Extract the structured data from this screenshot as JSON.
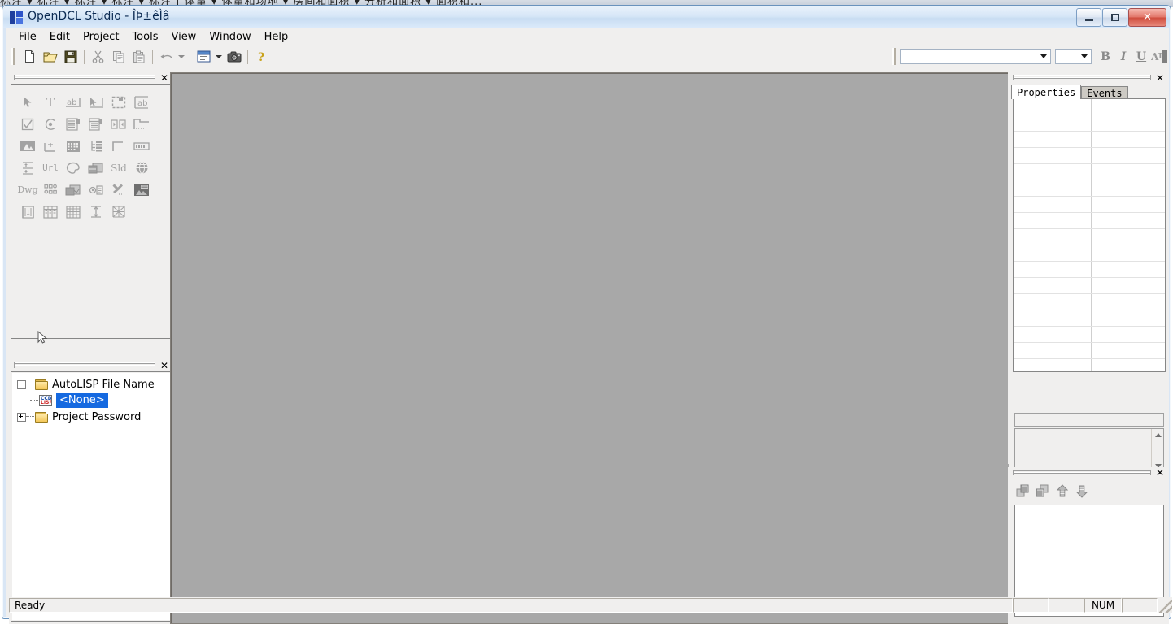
{
  "background_window": {
    "strip_text": "标注 ▾ 标注 ▾ 标注 ▾ 标注 ▾ 标注 | 体量 ▾ 体量和场地 ▾ 房间和面积 ▾ 分析和面积 ▾ 面积和..."
  },
  "window": {
    "title": "OpenDCL Studio - ÎÞ±êÌâ",
    "app_icon": "opendcl-logo-icon",
    "controls": {
      "minimize": "minimize-icon",
      "maximize": "restore-icon",
      "close": "✕"
    }
  },
  "menu": {
    "items": [
      {
        "label": "File"
      },
      {
        "label": "Edit"
      },
      {
        "label": "Project"
      },
      {
        "label": "Tools"
      },
      {
        "label": "View"
      },
      {
        "label": "Window"
      },
      {
        "label": "Help"
      }
    ]
  },
  "standard_toolbar": {
    "buttons": [
      {
        "name": "new-icon",
        "title": "New",
        "enabled": true
      },
      {
        "name": "open-icon",
        "title": "Open",
        "enabled": true
      },
      {
        "name": "save-icon",
        "title": "Save",
        "enabled": true
      },
      {
        "name": "cut-icon",
        "title": "Cut",
        "enabled": false
      },
      {
        "name": "copy-icon",
        "title": "Copy",
        "enabled": false
      },
      {
        "name": "paste-icon",
        "title": "Paste",
        "enabled": false
      },
      {
        "name": "undo-icon",
        "title": "Undo",
        "enabled": false
      },
      {
        "name": "new-form-icon",
        "title": "New Form",
        "enabled": true
      },
      {
        "name": "screenshot-icon",
        "title": "Capture",
        "enabled": true
      },
      {
        "name": "help-icon",
        "title": "Help",
        "enabled": true
      }
    ]
  },
  "format_toolbar": {
    "font_name": {
      "value": "",
      "placeholder": ""
    },
    "font_size": {
      "value": "",
      "placeholder": ""
    },
    "bold_label": "B",
    "italic_label": "I",
    "underline_label": "U",
    "fontcolor_label": "A",
    "fontcolor_swatch": "#808080"
  },
  "toolbox_panel": {
    "close_label": "✕",
    "tools": [
      {
        "name": "select-pointer-icon",
        "glyph": "pointer"
      },
      {
        "name": "label-text-icon",
        "glyph": "T"
      },
      {
        "name": "textbox-icon",
        "glyph": "ab"
      },
      {
        "name": "button-icon",
        "glyph": "btn"
      },
      {
        "name": "dialog-icon",
        "glyph": "dlg"
      },
      {
        "name": "edit-box-icon",
        "glyph": "fab"
      },
      {
        "name": "checkbox-icon",
        "glyph": "check"
      },
      {
        "name": "radio-button-icon",
        "glyph": "radio"
      },
      {
        "name": "listbox-icon",
        "glyph": "list1"
      },
      {
        "name": "listview-icon",
        "glyph": "list2"
      },
      {
        "name": "spinner-icon",
        "glyph": "spin"
      },
      {
        "name": "tab-control-icon",
        "glyph": "tabc"
      },
      {
        "name": "image-control-icon",
        "glyph": "image"
      },
      {
        "name": "angle-control-icon",
        "glyph": "angle"
      },
      {
        "name": "grid-control-icon",
        "glyph": "grid"
      },
      {
        "name": "tree-control-icon",
        "glyph": "tree"
      },
      {
        "name": "frame-icon",
        "glyph": "frame"
      },
      {
        "name": "progressbar-icon",
        "glyph": "progress"
      },
      {
        "name": "align-icon",
        "glyph": "align"
      },
      {
        "name": "url-control-icon",
        "glyph": "Url"
      },
      {
        "name": "color-picker-icon",
        "glyph": "palette"
      },
      {
        "name": "pattern-icon",
        "glyph": "pattern"
      },
      {
        "name": "slide-control-icon",
        "glyph": "Sld"
      },
      {
        "name": "web-browser-icon",
        "glyph": "globe"
      },
      {
        "name": "dwg-control-icon",
        "glyph": "Dwg"
      },
      {
        "name": "block-list-icon",
        "glyph": "blocks"
      },
      {
        "name": "hatch-icon",
        "glyph": "hatch"
      },
      {
        "name": "ole-control-icon",
        "glyph": "ole"
      },
      {
        "name": "tools-icon",
        "glyph": "tools"
      },
      {
        "name": "picture-icon",
        "glyph": "picture"
      },
      {
        "name": "dimension-icon",
        "glyph": "dim"
      },
      {
        "name": "report-icon",
        "glyph": "report"
      },
      {
        "name": "table-icon",
        "glyph": "table"
      },
      {
        "name": "spacing-icon",
        "glyph": "space"
      },
      {
        "name": "mesh-icon",
        "glyph": "mesh"
      }
    ]
  },
  "project_panel": {
    "close_label": "✕",
    "tree": [
      {
        "label": "AutoLISP File Name",
        "icon": "folder-icon",
        "expander": "minus",
        "expanded": true,
        "selected": false,
        "children": [
          {
            "label": "<None>",
            "icon": "lisp-file-icon",
            "selected": true
          }
        ]
      },
      {
        "label": "Project Password",
        "icon": "folder-icon",
        "expander": "plus",
        "expanded": false,
        "selected": false,
        "children": []
      }
    ]
  },
  "properties_panel": {
    "close_label": "✕",
    "tabs": [
      {
        "label": "Properties",
        "active": true
      },
      {
        "label": "Events",
        "active": false
      }
    ],
    "grid": {
      "rows": [],
      "row_count": 17,
      "empty": true
    },
    "description": "",
    "scroll": {
      "up": "scroll-up-arrow",
      "down": "scroll-down-arrow"
    }
  },
  "layout_panel": {
    "close_label": "✕",
    "tools": [
      {
        "name": "bring-to-front-icon"
      },
      {
        "name": "send-to-back-icon"
      },
      {
        "name": "move-up-icon"
      },
      {
        "name": "move-down-icon"
      }
    ],
    "list_items": []
  },
  "status_bar": {
    "message": "Ready",
    "indicators": [
      "",
      "",
      "NUM",
      ""
    ]
  },
  "colors": {
    "face": "#f0efee",
    "mdi_background": "#a8a8a8",
    "selection": "#1569e0",
    "accent": "#6a93bd",
    "disabled_icon": "#a3a3a3"
  }
}
